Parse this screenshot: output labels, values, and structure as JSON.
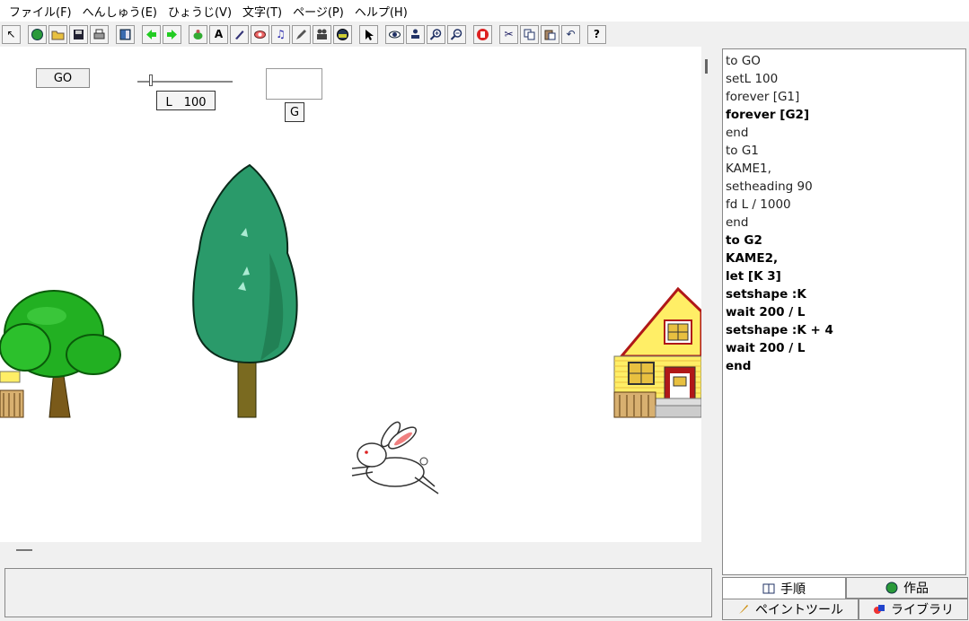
{
  "menu": {
    "items": [
      "ファイル(F)",
      "へんしゅう(E)",
      "ひょうじ(V)",
      "文字(T)",
      "ページ(P)",
      "ヘルプ(H)"
    ]
  },
  "toolbar": {
    "icons": [
      "arrow-small-icon",
      "globe-icon",
      "open-folder-icon",
      "save-icon",
      "print-icon",
      "panel-icon",
      "back-arrow-icon",
      "forward-arrow-icon",
      "turtle-icon",
      "text-box-icon",
      "pen-icon",
      "eye-oval-icon",
      "music-note-icon",
      "pencil-icon",
      "film-camera-icon",
      "globe-ball-icon",
      "pointer-icon",
      "eye-icon",
      "stamp-icon",
      "zoom-in-icon",
      "zoom-out-icon",
      "hand-stop-icon",
      "cut-icon",
      "copy-icon",
      "paste-icon",
      "undo-icon",
      "help-icon"
    ],
    "help_label": "?"
  },
  "stage": {
    "go_button": "GO",
    "slider_label": "L　100",
    "slider_value": 0.12,
    "g_button": "G"
  },
  "code": {
    "lines": [
      {
        "text": "to GO",
        "bold": false
      },
      {
        "text": "setL 100",
        "bold": false
      },
      {
        "text": "forever [G1]",
        "bold": false
      },
      {
        "text": "forever [G2]",
        "bold": true
      },
      {
        "text": "end",
        "bold": false
      },
      {
        "text": "to G1",
        "bold": false
      },
      {
        "text": "KAME1,",
        "bold": false
      },
      {
        "text": "setheading 90",
        "bold": false
      },
      {
        "text": "fd L / 1000",
        "bold": false
      },
      {
        "text": "end",
        "bold": false
      },
      {
        "text": "to G2",
        "bold": true
      },
      {
        "text": "KAME2,",
        "bold": true
      },
      {
        "text": "let [K 3]",
        "bold": true
      },
      {
        "text": "setshape :K",
        "bold": true
      },
      {
        "text": "wait 200 / L",
        "bold": true
      },
      {
        "text": "setshape :K + 4",
        "bold": true
      },
      {
        "text": "wait 200 / L",
        "bold": true
      },
      {
        "text": "end",
        "bold": true
      }
    ]
  },
  "tabs": {
    "procedures": "手順",
    "works": "作品",
    "paint_tool": "ペイントツール",
    "library": "ライブラリ"
  },
  "colors": {
    "tree_green": "#2a9a6a",
    "round_tree_green": "#22aa22",
    "trunk": "#7a5a1a",
    "house_yellow": "#ffee66",
    "roof_red": "#b01818"
  }
}
